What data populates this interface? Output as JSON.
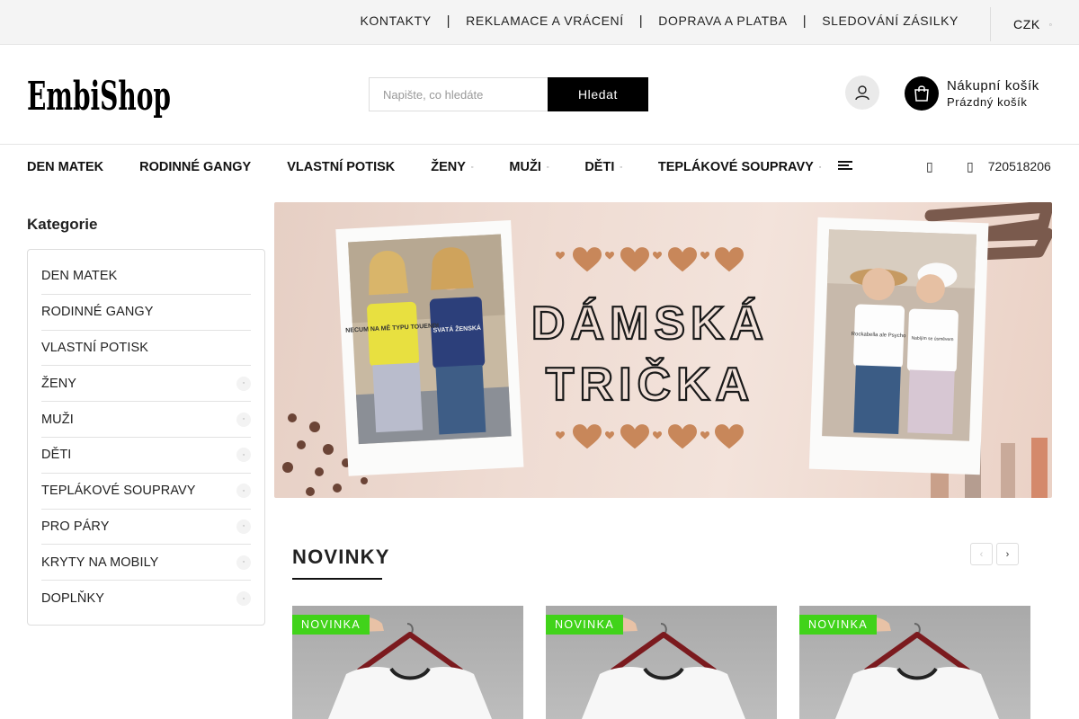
{
  "topbar": {
    "links": [
      "KONTAKTY",
      "REKLAMACE A VRÁCENÍ",
      "DOPRAVA A PLATBA",
      "SLEDOVÁNÍ ZÁSILKY"
    ],
    "separator": "|",
    "currency": "CZK"
  },
  "header": {
    "logo_text": "EmbiShop",
    "search_placeholder": "Napište, co hledáte",
    "search_button": "Hledat",
    "cart_title": "Nákupní košík",
    "cart_status": "Prázdný košík"
  },
  "nav": {
    "items": [
      {
        "label": "DEN MATEK",
        "has_sub": false
      },
      {
        "label": "RODINNÉ GANGY",
        "has_sub": false
      },
      {
        "label": "VLASTNÍ POTISK",
        "has_sub": false
      },
      {
        "label": "ŽENY",
        "has_sub": true
      },
      {
        "label": "MUŽI",
        "has_sub": true
      },
      {
        "label": "DĚTI",
        "has_sub": true
      },
      {
        "label": "TEPLÁKOVÉ SOUPRAVY",
        "has_sub": true
      }
    ],
    "phone": "720518206",
    "caret_glyph": "▫",
    "contact_glyph": "▯"
  },
  "sidebar": {
    "title": "Kategorie",
    "items": [
      {
        "label": "DEN MATEK",
        "has_sub": false
      },
      {
        "label": "RODINNÉ GANGY",
        "has_sub": false
      },
      {
        "label": "VLASTNÍ POTISK",
        "has_sub": false
      },
      {
        "label": "ŽENY",
        "has_sub": true
      },
      {
        "label": "MUŽI",
        "has_sub": true
      },
      {
        "label": "DĚTI",
        "has_sub": true
      },
      {
        "label": "TEPLÁKOVÉ SOUPRAVY",
        "has_sub": true
      },
      {
        "label": "PRO PÁRY",
        "has_sub": true
      },
      {
        "label": "KRYTY NA MOBILY",
        "has_sub": true
      },
      {
        "label": "DOPLŇKY",
        "has_sub": true
      }
    ]
  },
  "banner": {
    "line1": "DÁMSKÁ",
    "line2": "TRIČKA",
    "shirt_left_text": "NECUM NA MĚ TYPU TOUENDI",
    "shirt_left_text2": "SVATÁ ŽENSKÁ",
    "shirt_right_text": "Rockabella ale Psycho",
    "shirt_right_text2": "Nabíjím se úsměvem"
  },
  "novinky": {
    "title": "NOVINKY",
    "prev_label": "‹",
    "next_label": "›",
    "products": [
      {
        "badge": "NOVINKA"
      },
      {
        "badge": "NOVINKA"
      },
      {
        "badge": "NOVINKA"
      }
    ]
  },
  "colors": {
    "badge_green": "#41d31a",
    "banner_bg": "#efdcd3",
    "heart_brown": "#c8875a",
    "topbar_bg": "#f4f4f4"
  }
}
